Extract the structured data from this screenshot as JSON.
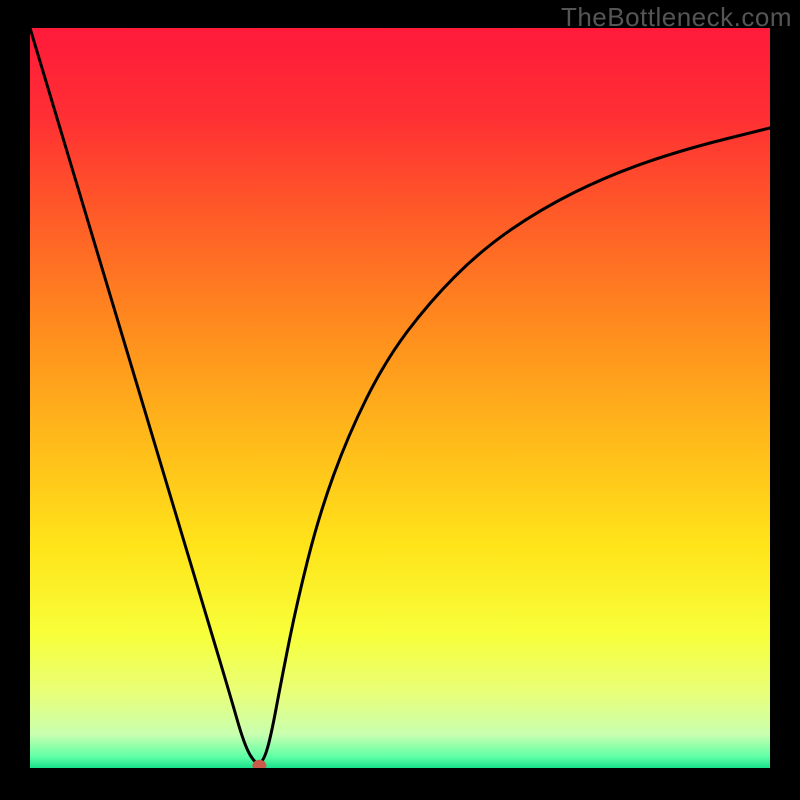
{
  "watermark": "TheBottleneck.com",
  "chart_data": {
    "type": "line",
    "title": "",
    "xlabel": "",
    "ylabel": "",
    "xlim": [
      0,
      100
    ],
    "ylim": [
      0,
      100
    ],
    "gradient_stops": [
      {
        "offset": 0.0,
        "color": "#ff1a3a"
      },
      {
        "offset": 0.12,
        "color": "#ff2f34"
      },
      {
        "offset": 0.25,
        "color": "#ff5a28"
      },
      {
        "offset": 0.4,
        "color": "#ff8a1e"
      },
      {
        "offset": 0.55,
        "color": "#ffb81a"
      },
      {
        "offset": 0.7,
        "color": "#ffe41a"
      },
      {
        "offset": 0.82,
        "color": "#f7ff3a"
      },
      {
        "offset": 0.9,
        "color": "#e8ff7a"
      },
      {
        "offset": 0.955,
        "color": "#c8ffb0"
      },
      {
        "offset": 0.985,
        "color": "#5effa5"
      },
      {
        "offset": 1.0,
        "color": "#18e08a"
      }
    ],
    "series": [
      {
        "name": "curve",
        "x": [
          0.0,
          3.0,
          6.0,
          9.0,
          12.0,
          15.0,
          18.0,
          21.0,
          24.0,
          27.0,
          29.0,
          30.5,
          31.5,
          32.5,
          34.0,
          36.0,
          39.0,
          43.0,
          48.0,
          54.0,
          61.0,
          69.0,
          78.0,
          88.0,
          100.0
        ],
        "y": [
          100.0,
          90.0,
          80.0,
          70.0,
          60.0,
          50.0,
          40.0,
          30.0,
          20.0,
          10.0,
          3.0,
          0.5,
          0.8,
          4.0,
          12.0,
          22.0,
          34.0,
          45.0,
          55.0,
          63.0,
          70.0,
          75.5,
          80.0,
          83.5,
          86.5
        ]
      }
    ],
    "marker": {
      "x": 31.0,
      "y": 0.3,
      "color": "#cc5a4a",
      "r": 6
    }
  }
}
